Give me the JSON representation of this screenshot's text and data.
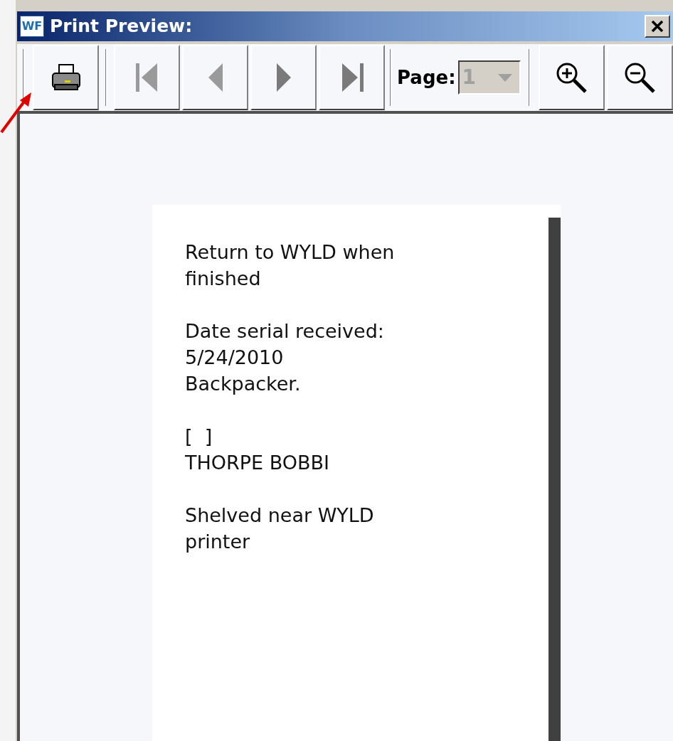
{
  "window": {
    "title": "Print Preview:",
    "app_icon": "WF"
  },
  "toolbar": {
    "buttons": [
      {
        "kind": "print"
      },
      {
        "kind": "first",
        "disabled": true
      },
      {
        "kind": "prev",
        "disabled": true
      },
      {
        "kind": "next",
        "disabled": false
      },
      {
        "kind": "last",
        "disabled": false
      }
    ],
    "page": {
      "label": "Page:",
      "value": "1",
      "disabled": true
    },
    "zoom_buttons": [
      {
        "kind": "zoom_in"
      },
      {
        "kind": "zoom_out"
      }
    ]
  },
  "document": {
    "paragraphs": [
      [
        "Return to WYLD when",
        "finished"
      ],
      [
        "Date serial received:",
        "5/24/2010",
        "Backpacker."
      ],
      [
        "[  ]",
        "THORPE BOBBI"
      ],
      [
        "Shelved near WYLD",
        "printer"
      ]
    ]
  }
}
